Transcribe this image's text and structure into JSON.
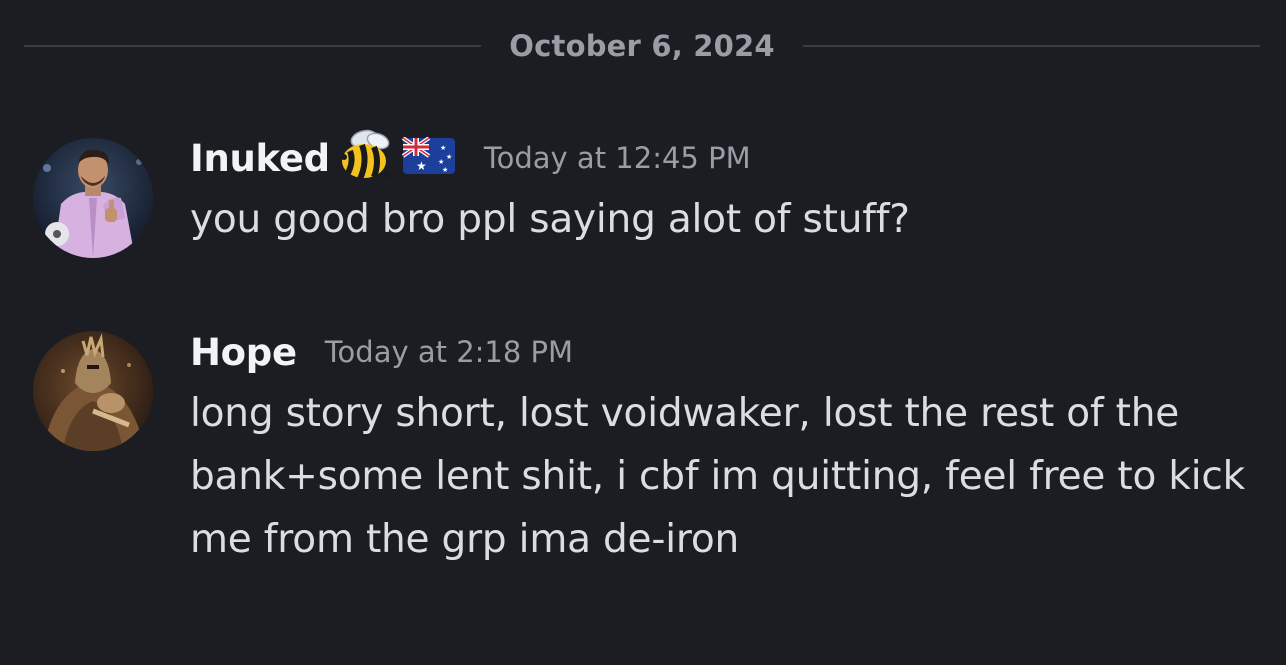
{
  "divider": {
    "date": "October 6, 2024"
  },
  "messages": [
    {
      "username": "Inuked",
      "emojis": [
        "bee-emoji",
        "australia-flag-emoji"
      ],
      "timestamp": "Today at 12:45 PM",
      "text": "you good bro ppl saying alot of stuff?"
    },
    {
      "username": "Hope",
      "timestamp": "Today at 2:18 PM",
      "text": "long story short, lost voidwaker, lost the rest of the bank+some lent shit, i cbf im quitting, feel free to kick me from the grp ima de-iron"
    }
  ],
  "colors": {
    "background": "#1c1d22",
    "username": "#f2f3f5",
    "muted": "#9a9ca6",
    "text": "#dbdee1"
  }
}
